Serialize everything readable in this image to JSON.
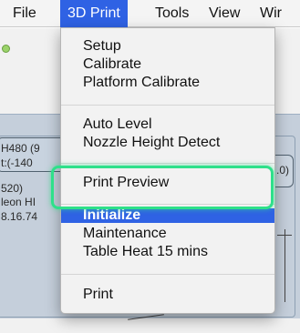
{
  "menubar": {
    "items": [
      "File",
      "3D Print",
      "Tools",
      "View",
      "Wir"
    ]
  },
  "background": {
    "left_texts": [
      "H480 (9",
      "t:(-140",
      "520)",
      "leon HI",
      "8.16.74"
    ],
    "right_text": ".0)"
  },
  "menu": {
    "group1": [
      "Setup",
      "Calibrate",
      "Platform Calibrate"
    ],
    "group2": [
      "Auto Level",
      "Nozzle Height Detect"
    ],
    "group3": [
      "Print Preview"
    ],
    "group4": [
      "Initialize",
      "Maintenance",
      "Table Heat 15 mins"
    ],
    "group5": [
      "Print"
    ]
  },
  "colors": {
    "selection_blue": "#2f62e4",
    "highlight_green": "#2ee08a"
  }
}
